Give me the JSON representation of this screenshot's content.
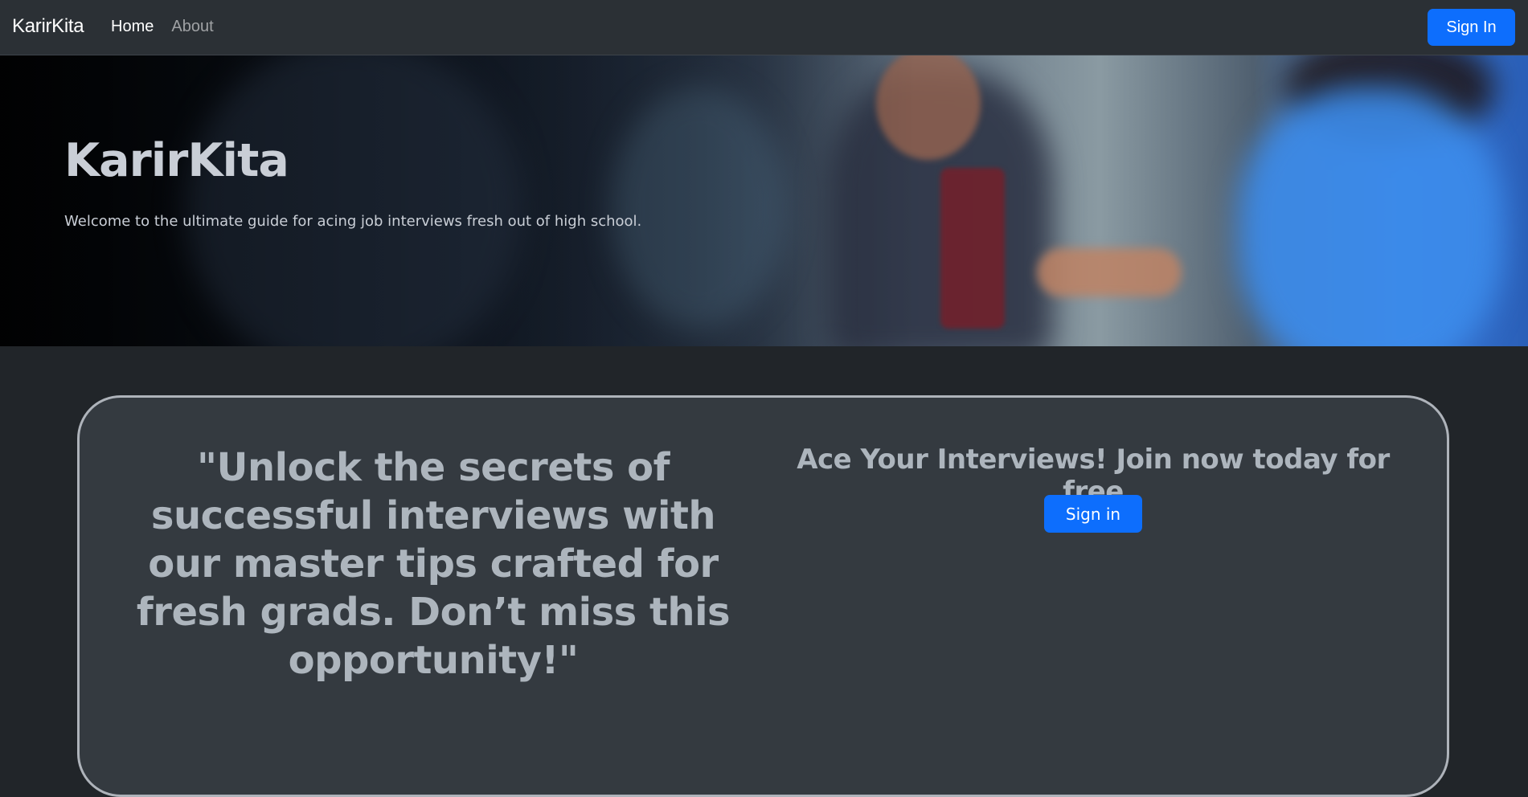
{
  "navbar": {
    "brand": "KarirKita",
    "links": [
      {
        "label": "Home",
        "active": true
      },
      {
        "label": "About",
        "active": false
      }
    ],
    "sign_in_label": "Sign In"
  },
  "hero": {
    "title": "KarirKita",
    "subtitle": "Welcome to the ultimate guide for acing job interviews fresh out of high school."
  },
  "card": {
    "quote": "\"Unlock the secrets of successful interviews with our master tips crafted for fresh grads. Don’t miss this opportunity!\"",
    "cta_title": "Ace Your Interviews! Join now today for free",
    "cta_button_label": "Sign in"
  },
  "colors": {
    "accent": "#0d6efd",
    "page_background": "#212529",
    "navbar_background": "#2b3035",
    "card_background": "#343a40",
    "muted_text": "#adb5bd"
  }
}
